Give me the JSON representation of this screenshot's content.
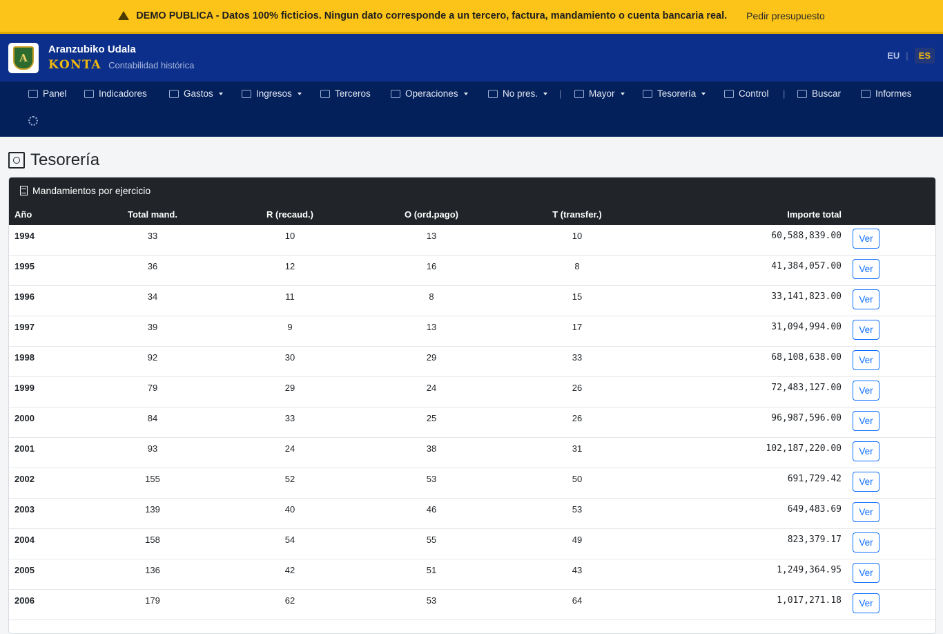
{
  "banner": {
    "message": "DEMO PUBLICA - Datos 100% ficticios. Ningun dato corresponde a un tercero, factura, mandamiento o cuenta bancaria real.",
    "cta": "Pedir presupuesto"
  },
  "header": {
    "org_name": "Aranzubiko Udala",
    "app_name": "KONTA",
    "subtitle": "Contabilidad histórica",
    "logo_letter": "A",
    "lang": {
      "eu": "EU",
      "separator": "|",
      "es": "ES",
      "active": "ES"
    }
  },
  "nav": {
    "items": [
      {
        "label": "Panel",
        "icon": "dashboard-icon"
      },
      {
        "label": "Indicadores",
        "icon": "chart-line-icon"
      },
      {
        "label": "Gastos",
        "icon": "wallet-icon",
        "dropdown": true
      },
      {
        "label": "Ingresos",
        "icon": "piggy-bank-icon",
        "dropdown": true
      },
      {
        "label": "Terceros",
        "icon": "people-icon"
      },
      {
        "label": "Operaciones",
        "icon": "list-icon",
        "dropdown": true
      },
      {
        "label": "No pres.",
        "icon": "bank-icon",
        "dropdown": true
      },
      {
        "label": "Mayor",
        "icon": "journal-icon",
        "dropdown": true
      },
      {
        "label": "Tesorería",
        "icon": "safe-icon",
        "dropdown": true
      },
      {
        "label": "Control",
        "icon": "shield-icon"
      },
      {
        "label": "Buscar",
        "icon": "search-icon"
      },
      {
        "label": "Informes",
        "icon": "report-icon"
      }
    ],
    "settings_icon": "gear-icon"
  },
  "page": {
    "title": "Tesorería",
    "title_icon": "safe-icon"
  },
  "card": {
    "title": "Mandamientos por ejercicio",
    "icon": "document-icon"
  },
  "table": {
    "columns": [
      "Año",
      "Total mand.",
      "R (recaud.)",
      "O (ord.pago)",
      "T (transfer.)",
      "Importe total",
      ""
    ],
    "action_label": "Ver",
    "rows": [
      {
        "year": "1994",
        "total": "33",
        "r": "10",
        "o": "13",
        "t": "10",
        "amount": "60,588,839.00"
      },
      {
        "year": "1995",
        "total": "36",
        "r": "12",
        "o": "16",
        "t": "8",
        "amount": "41,384,057.00"
      },
      {
        "year": "1996",
        "total": "34",
        "r": "11",
        "o": "8",
        "t": "15",
        "amount": "33,141,823.00"
      },
      {
        "year": "1997",
        "total": "39",
        "r": "9",
        "o": "13",
        "t": "17",
        "amount": "31,094,994.00"
      },
      {
        "year": "1998",
        "total": "92",
        "r": "30",
        "o": "29",
        "t": "33",
        "amount": "68,108,638.00"
      },
      {
        "year": "1999",
        "total": "79",
        "r": "29",
        "o": "24",
        "t": "26",
        "amount": "72,483,127.00"
      },
      {
        "year": "2000",
        "total": "84",
        "r": "33",
        "o": "25",
        "t": "26",
        "amount": "96,987,596.00"
      },
      {
        "year": "2001",
        "total": "93",
        "r": "24",
        "o": "38",
        "t": "31",
        "amount": "102,187,220.00"
      },
      {
        "year": "2002",
        "total": "155",
        "r": "52",
        "o": "53",
        "t": "50",
        "amount": "691,729.42"
      },
      {
        "year": "2003",
        "total": "139",
        "r": "40",
        "o": "46",
        "t": "53",
        "amount": "649,483.69"
      },
      {
        "year": "2004",
        "total": "158",
        "r": "54",
        "o": "55",
        "t": "49",
        "amount": "823,379.17"
      },
      {
        "year": "2005",
        "total": "136",
        "r": "42",
        "o": "51",
        "t": "43",
        "amount": "1,249,364.95"
      },
      {
        "year": "2006",
        "total": "179",
        "r": "62",
        "o": "53",
        "t": "64",
        "amount": "1,017,271.18"
      }
    ]
  }
}
